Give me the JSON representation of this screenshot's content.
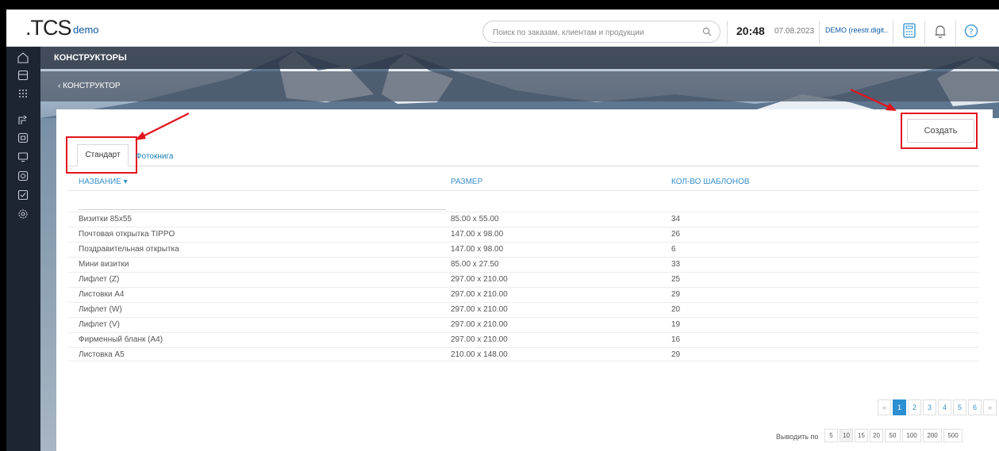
{
  "header": {
    "logo": ".TCS",
    "logo_sub": "demo",
    "search_placeholder": "Поиск по заказам, клиентам и продукции",
    "time": "20:48",
    "date": "07.08.2023",
    "user": "DEMO (reestr.digit..."
  },
  "sidebar": {
    "icons": [
      "home-icon",
      "orders-icon",
      "grid-icon",
      "flow-icon",
      "print-icon",
      "monitor-icon",
      "stamp-icon",
      "checklist-icon",
      "settings-icon"
    ]
  },
  "banner": {
    "section_title": "КОНСТРУКТОРЫ",
    "back_label": "КОНСТРУКТОР"
  },
  "toolbar": {
    "create_label": "Создать"
  },
  "tabs": [
    {
      "label": "Стандарт",
      "active": true
    },
    {
      "label": "Фотокнига",
      "active": false
    }
  ],
  "table": {
    "columns": [
      "НАЗВАНИЕ ▾",
      "РАЗМЕР",
      "КОЛ-ВО ШАБЛОНОВ"
    ],
    "rows": [
      [
        "Визитки 85x55",
        "85.00 x 55.00",
        "34"
      ],
      [
        "Почтовая открытка TIPPO",
        "147.00 x 98.00",
        "26"
      ],
      [
        "Поздравительная открытка",
        "147.00 x 98.00",
        "6"
      ],
      [
        "Мини визитки",
        "85.00 x 27.50",
        "33"
      ],
      [
        "Лифлет (Z)",
        "297.00 x 210.00",
        "25"
      ],
      [
        "Листовки А4",
        "297.00 x 210.00",
        "29"
      ],
      [
        "Лифлет (W)",
        "297.00 x 210.00",
        "20"
      ],
      [
        "Лифлет (V)",
        "297.00 x 210.00",
        "19"
      ],
      [
        "Фирменный бланк (А4)",
        "297.00 x 210.00",
        "16"
      ],
      [
        "Листовка А5",
        "210.00 x 148.00",
        "29"
      ]
    ]
  },
  "pagination": {
    "prev": "«",
    "pages": [
      "1",
      "2",
      "3",
      "4",
      "5",
      "6"
    ],
    "current": "1",
    "next": "»"
  },
  "per_page": {
    "label": "Выводить по",
    "options": [
      "5",
      "10",
      "15",
      "20",
      "50",
      "100",
      "200",
      "500"
    ],
    "selected": "10"
  },
  "colors": {
    "accent": "#2b8fd1",
    "highlight": "#e3131d",
    "sidebar": "#1d2532",
    "logo_sub": "#0e5aa7"
  }
}
